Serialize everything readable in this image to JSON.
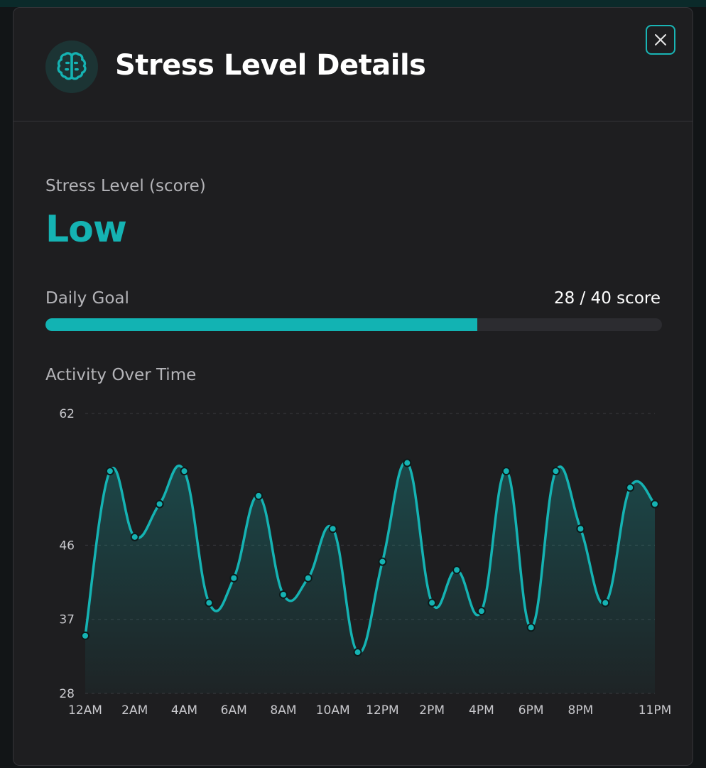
{
  "modal": {
    "title": "Stress Level Details",
    "close_icon": "close-icon",
    "header_icon": "brain-icon"
  },
  "stress": {
    "label": "Stress Level (score)",
    "value": "Low"
  },
  "goal": {
    "label": "Daily Goal",
    "value_text": "28 / 40 score",
    "current": 28,
    "target": 40
  },
  "activity": {
    "label": "Activity Over Time"
  },
  "colors": {
    "accent": "#15b3b3",
    "background": "#1e1e20",
    "track": "#2c2c30"
  },
  "chart_data": {
    "type": "area",
    "x": [
      "12AM",
      "1AM",
      "2AM",
      "3AM",
      "4AM",
      "5AM",
      "6AM",
      "7AM",
      "8AM",
      "9AM",
      "10AM",
      "11AM",
      "12PM",
      "1PM",
      "2PM",
      "3PM",
      "4PM",
      "5PM",
      "6PM",
      "7PM",
      "8PM",
      "9PM",
      "10PM",
      "11PM"
    ],
    "values": [
      35,
      55,
      47,
      51,
      55,
      39,
      42,
      52,
      40,
      42,
      48,
      33,
      44,
      56,
      39,
      43,
      38,
      55,
      36,
      55,
      48,
      39,
      53,
      51
    ],
    "x_tick_labels": [
      "12AM",
      "2AM",
      "4AM",
      "6AM",
      "8AM",
      "10AM",
      "12PM",
      "2PM",
      "4PM",
      "6PM",
      "8PM",
      "11PM"
    ],
    "x_tick_indices": [
      0,
      2,
      4,
      6,
      8,
      10,
      12,
      14,
      16,
      18,
      20,
      23
    ],
    "y_ticks": [
      28,
      37,
      46,
      62
    ],
    "ylim": [
      28,
      62
    ],
    "grid": true
  }
}
